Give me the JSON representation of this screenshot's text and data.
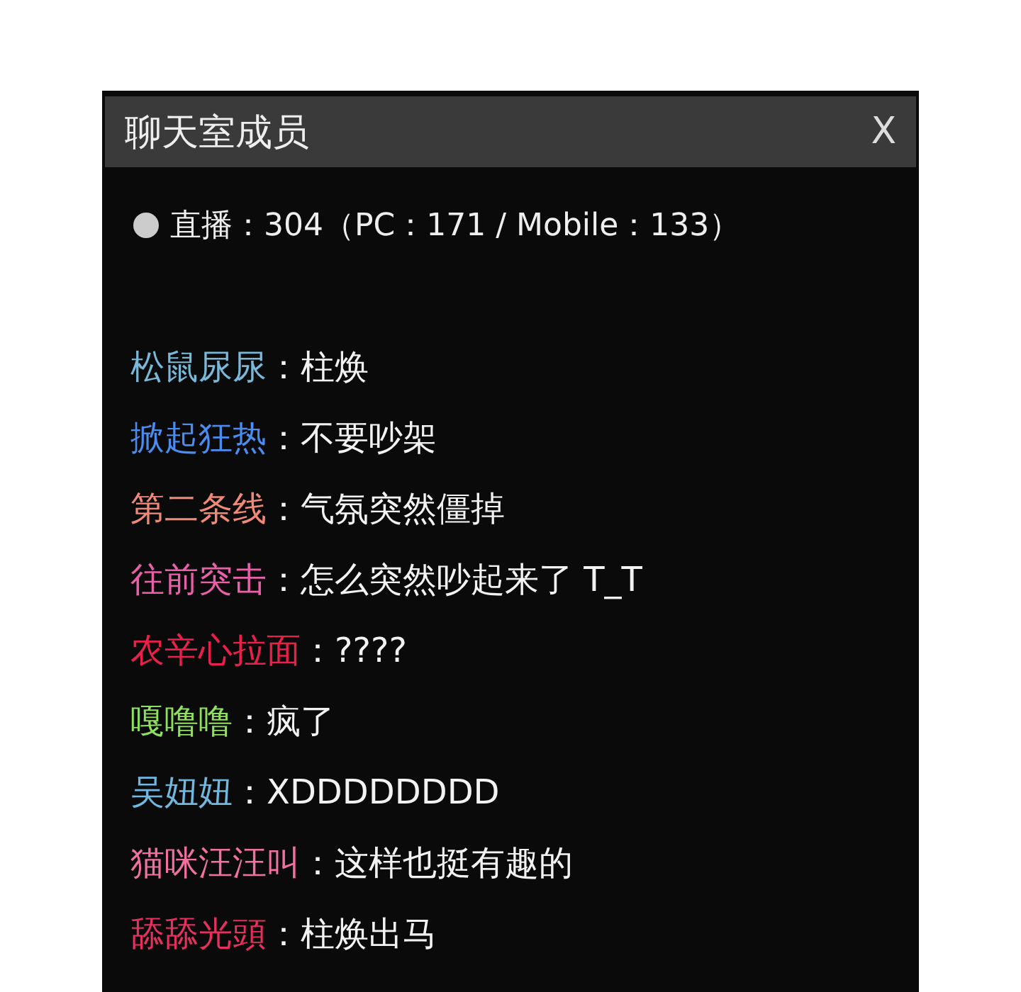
{
  "window": {
    "title": "聊天室成员",
    "close": "X"
  },
  "status": {
    "label": "直播：304（PC：171 / Mobile：133）"
  },
  "messages": [
    {
      "name": "松鼠尿尿",
      "color": "#7ab8d8",
      "text": "：柱焕"
    },
    {
      "name": "掀起狂热",
      "color": "#4a8cf0",
      "text": "：不要吵架"
    },
    {
      "name": "第二条线",
      "color": "#f08a78",
      "text": "：气氛突然僵掉"
    },
    {
      "name": "往前突击",
      "color": "#e860a8",
      "text": "：怎么突然吵起来了 T_T"
    },
    {
      "name": "农辛心拉面",
      "color": "#e8204a",
      "text": "：????"
    },
    {
      "name": "嘎噜噜",
      "color": "#90e060",
      "text": "：疯了"
    },
    {
      "name": "吴妞妞",
      "color": "#70b8e0",
      "text": "：XDDDDDDDD"
    },
    {
      "name": "猫咪汪汪叫",
      "color": "#f070a0",
      "text": "：这样也挺有趣的"
    },
    {
      "name": "舔舔光頭",
      "color": "#e83060",
      "text": "：柱焕出马"
    }
  ]
}
